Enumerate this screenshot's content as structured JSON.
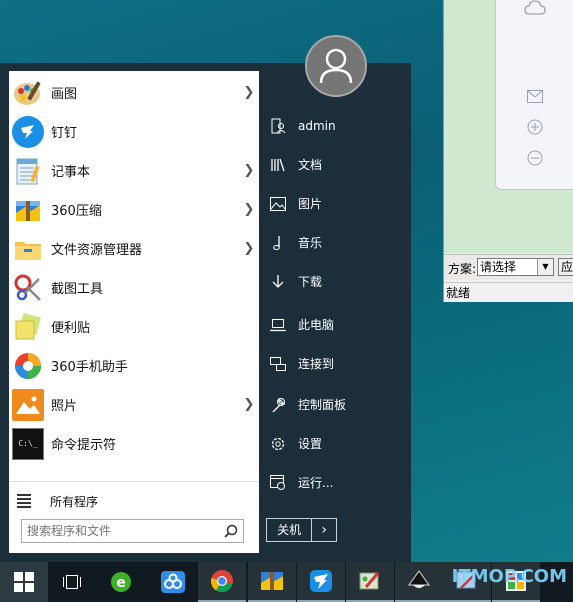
{
  "background_window": {
    "scheme_label": "方案:",
    "scheme_value": "请选择",
    "apply_button": "应",
    "status_text": "就绪"
  },
  "start_menu": {
    "apps": [
      {
        "label": "画图",
        "icon": "paint-icon",
        "has_submenu": true
      },
      {
        "label": "钉钉",
        "icon": "dingtalk-icon",
        "has_submenu": false
      },
      {
        "label": "记事本",
        "icon": "notepad-icon",
        "has_submenu": true
      },
      {
        "label": "360压缩",
        "icon": "360zip-icon",
        "has_submenu": true
      },
      {
        "label": "文件资源管理器",
        "icon": "file-explorer-icon",
        "has_submenu": true
      },
      {
        "label": "截图工具",
        "icon": "snipping-tool-icon",
        "has_submenu": false
      },
      {
        "label": "便利贴",
        "icon": "sticky-notes-icon",
        "has_submenu": false
      },
      {
        "label": "360手机助手",
        "icon": "360-mobile-icon",
        "has_submenu": false
      },
      {
        "label": "照片",
        "icon": "photos-icon",
        "has_submenu": true
      },
      {
        "label": "命令提示符",
        "icon": "cmd-icon",
        "has_submenu": false
      }
    ],
    "all_programs_label": "所有程序",
    "search_placeholder": "搜索程序和文件",
    "right_items": [
      {
        "label": "admin",
        "icon": "user-folder-icon"
      },
      {
        "label": "文档",
        "icon": "documents-icon"
      },
      {
        "label": "图片",
        "icon": "pictures-icon"
      },
      {
        "label": "音乐",
        "icon": "music-icon"
      },
      {
        "label": "下载",
        "icon": "download-icon"
      },
      {
        "label": "此电脑",
        "icon": "computer-icon"
      },
      {
        "label": "连接到",
        "icon": "connect-icon"
      },
      {
        "label": "控制面板",
        "icon": "control-panel-icon"
      },
      {
        "label": "设置",
        "icon": "settings-gear-icon"
      },
      {
        "label": "运行...",
        "icon": "run-icon"
      }
    ],
    "shutdown_label": "关机",
    "shutdown_arrow": "›"
  },
  "taskbar": {
    "watermark": "ITMOP.COM",
    "buttons": [
      "windows-start-icon",
      "task-view-icon",
      "ie-browser-icon",
      "baidu-netdisk-icon",
      "chrome-icon",
      "360zip-icon",
      "dingtalk-icon",
      "paint-app-icon",
      "inkscape-icon",
      "snipping-tool-icon",
      "sogou-icon"
    ]
  },
  "colors": {
    "desktop": "#0b5e74",
    "start_menu_bg": "#1b2e3a",
    "taskbar_bg": "#111a20"
  }
}
